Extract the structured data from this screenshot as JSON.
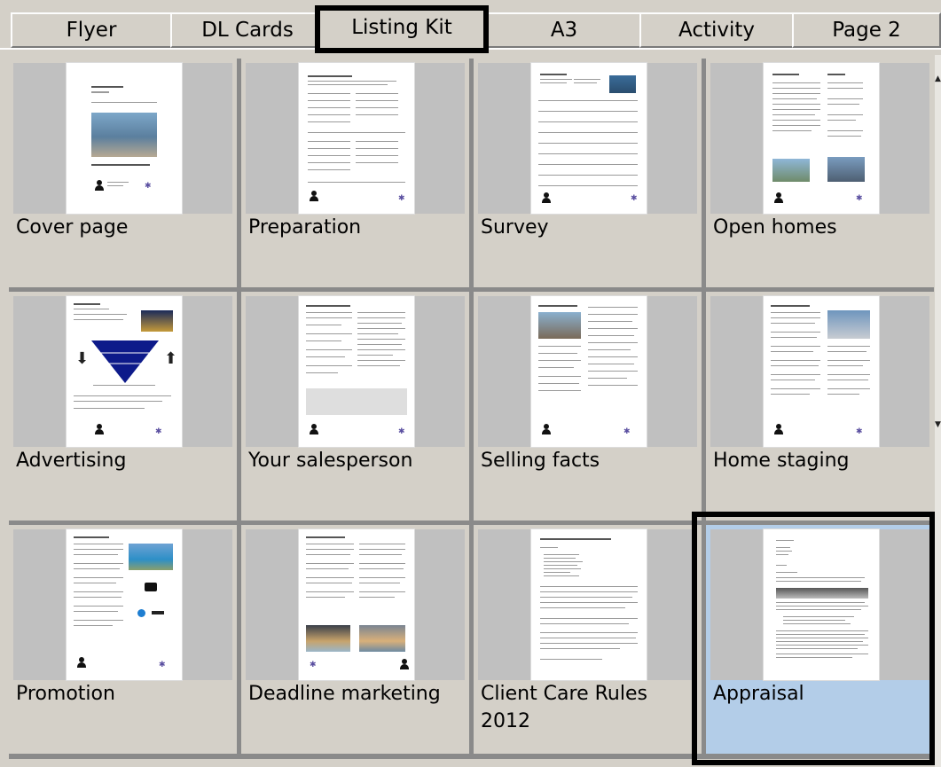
{
  "tabs": [
    {
      "label": "Flyer"
    },
    {
      "label": "DL Cards"
    },
    {
      "label": "Listing Kit"
    },
    {
      "label": "A3"
    },
    {
      "label": "Activity"
    },
    {
      "label": "Page 2"
    }
  ],
  "active_tab": "Listing Kit",
  "items": [
    {
      "label": "Cover page"
    },
    {
      "label": "Preparation"
    },
    {
      "label": "Survey"
    },
    {
      "label": "Open homes"
    },
    {
      "label": "Advertising"
    },
    {
      "label": "Your salesperson"
    },
    {
      "label": "Selling facts"
    },
    {
      "label": "Home staging"
    },
    {
      "label": "Promotion"
    },
    {
      "label": "Deadline marketing"
    },
    {
      "label": "Client Care Rules 2012"
    },
    {
      "label": "Appraisal"
    }
  ],
  "selected_item": "Appraisal",
  "colors": {
    "background": "#d4d0c8",
    "selected": "#b3cde8",
    "thumb_bg": "#c0c0c0"
  }
}
